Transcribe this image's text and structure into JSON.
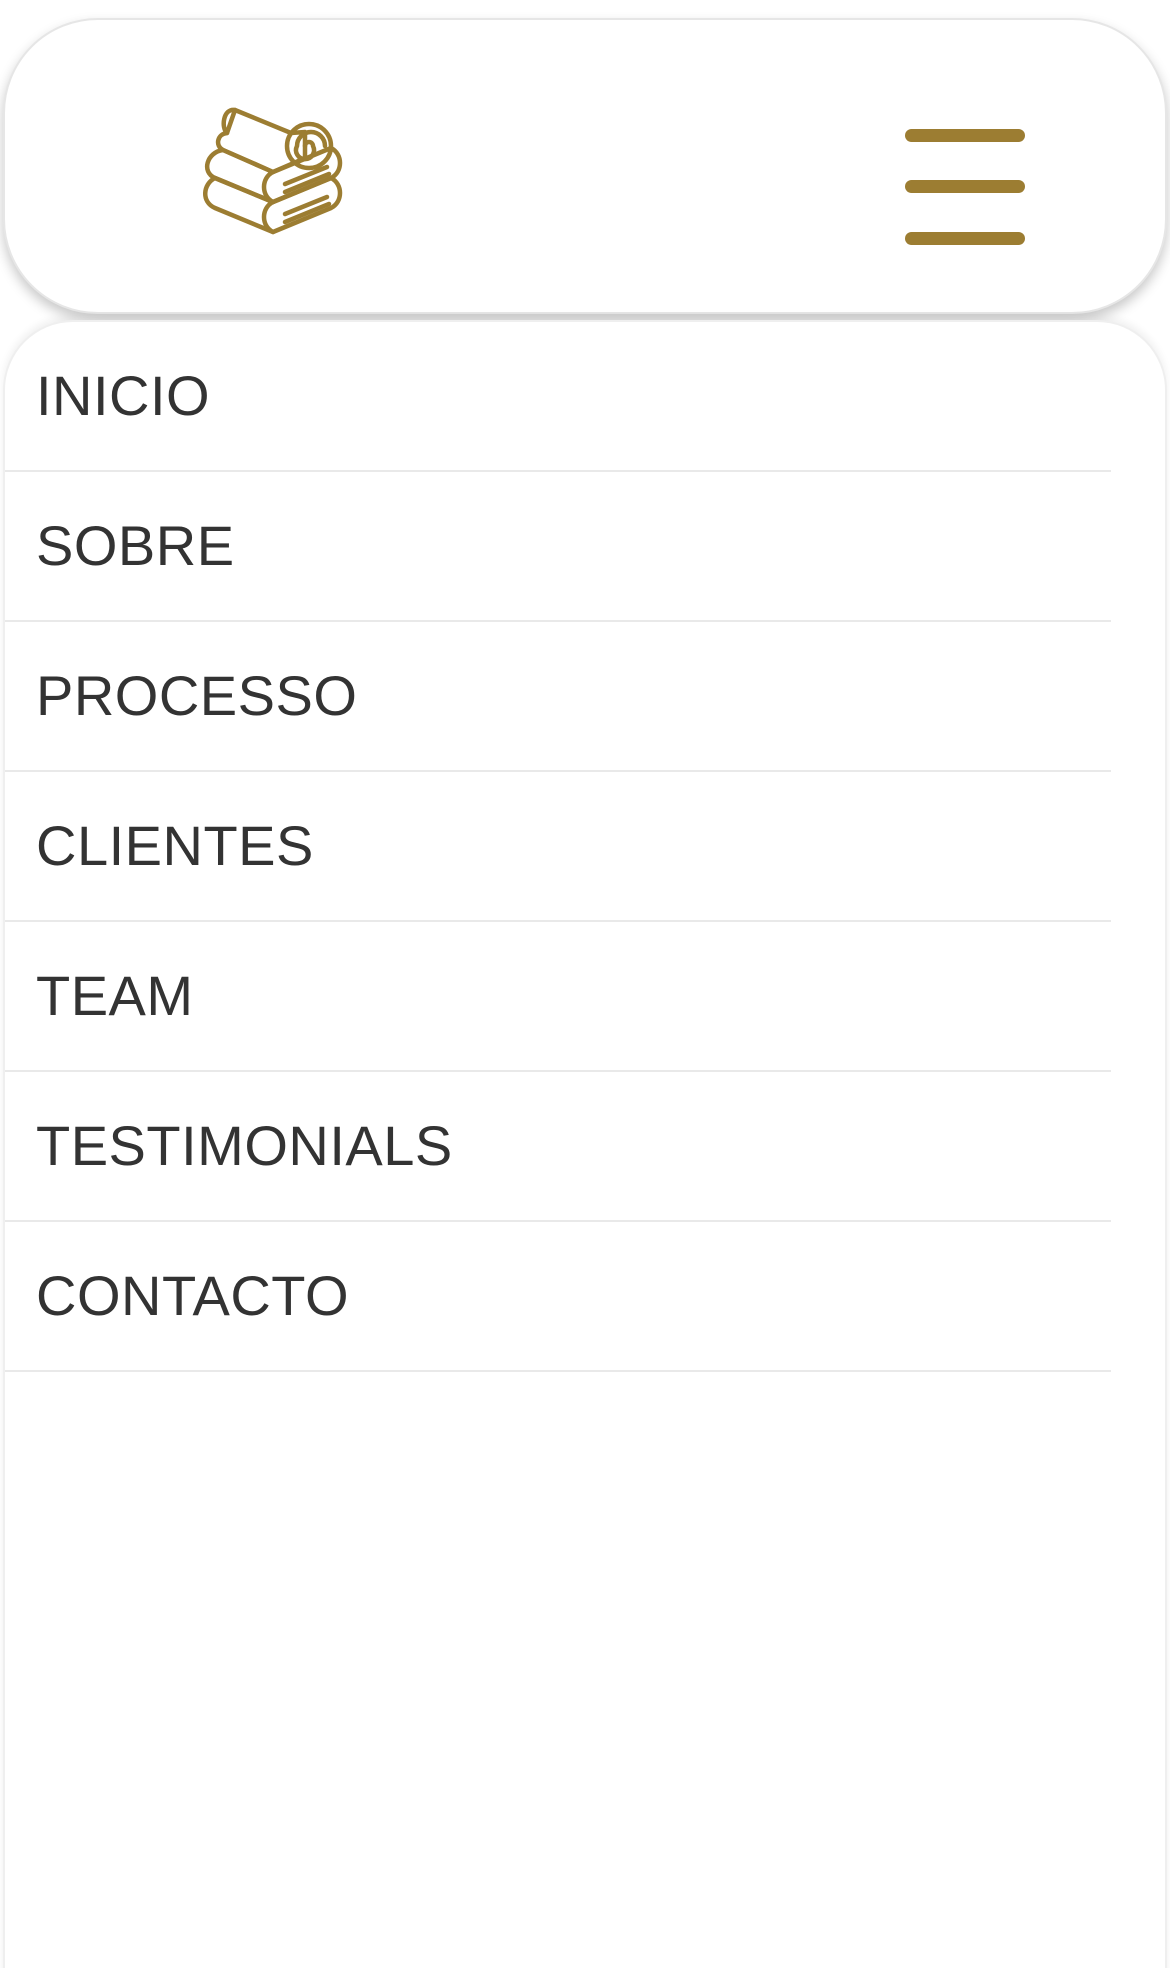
{
  "header": {
    "logo_icon": "towel-stack-icon",
    "menu_icon": "hamburger-menu-icon"
  },
  "colors": {
    "accent": "#9c7d32",
    "text": "#333333",
    "divider": "#e9e9e9",
    "background": "#ffffff"
  },
  "menu": {
    "items": [
      {
        "label": "INICIO"
      },
      {
        "label": "SOBRE"
      },
      {
        "label": "PROCESSO"
      },
      {
        "label": "CLIENTES"
      },
      {
        "label": "TEAM"
      },
      {
        "label": "TESTIMONIALS"
      },
      {
        "label": "CONTACTO"
      }
    ]
  }
}
